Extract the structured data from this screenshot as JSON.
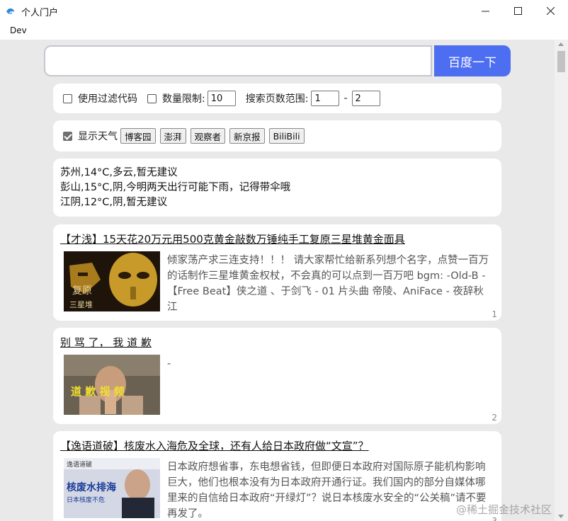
{
  "window": {
    "title": "个人门户",
    "min_glyph": "—",
    "max_glyph": "☐",
    "close_glyph": "✕"
  },
  "menu": {
    "dev": "Dev"
  },
  "search": {
    "value": "",
    "button_label": "百度一下"
  },
  "options": {
    "filter_label": "使用过滤代码",
    "limit_label": "数量限制:",
    "limit_value": "10",
    "range_label": "搜索页数范围:",
    "range_from": "1",
    "range_sep": "-",
    "range_to": "2"
  },
  "sites": {
    "weather_label": "显示天气",
    "buttons": [
      "博客园",
      "澎湃",
      "观察者",
      "新京报",
      "BiliBili"
    ]
  },
  "weather": {
    "lines": [
      "苏州,14°C,多云,暂无建议",
      "彭山,15°C,阴,今明两天出行可能下雨，记得带伞哦",
      "江阴,12°C,阴,暂无建议"
    ]
  },
  "articles": [
    {
      "title": "【才浅】15天花20万元用500克黄金敲数万锤纯手工复原三星堆黄金面具",
      "desc": "倾家荡产求三连支持！！！ 请大家帮忙给新系列想个名字，点赞一百万的话制作三星堆黄金权杖，不会真的可以点到一百万吧 bgm: -Old-B - 【Free Beat】侠之道 、于剑飞 - 01 片头曲 帝陵、AniFace - 夜辞秋江",
      "thumb_text_1": "复原",
      "thumb_text_2": "三星堆",
      "index": "1"
    },
    {
      "title": "别 骂 了， 我 道 歉",
      "desc": "-",
      "thumb_text_1": "道 歉 视 频",
      "index": "2"
    },
    {
      "title": "【逸语道破】核废水入海危及全球，还有人给日本政府做“文宣”？",
      "desc": "日本政府想省事，东电想省钱，但即便日本政府对国际原子能机构影响巨大，他们也根本没有为日本政府开通行证。我们国内的部分自媒体哪里来的自信给日本政府“开绿灯”？说日本核废水安全的“公关稿”请不要再发了。",
      "thumb_text_1": "逸语道破",
      "thumb_text_2": "核废水排海",
      "thumb_text_3": "日本核废不危",
      "index": "3"
    }
  ],
  "watermark": "@稀土掘金技术社区"
}
